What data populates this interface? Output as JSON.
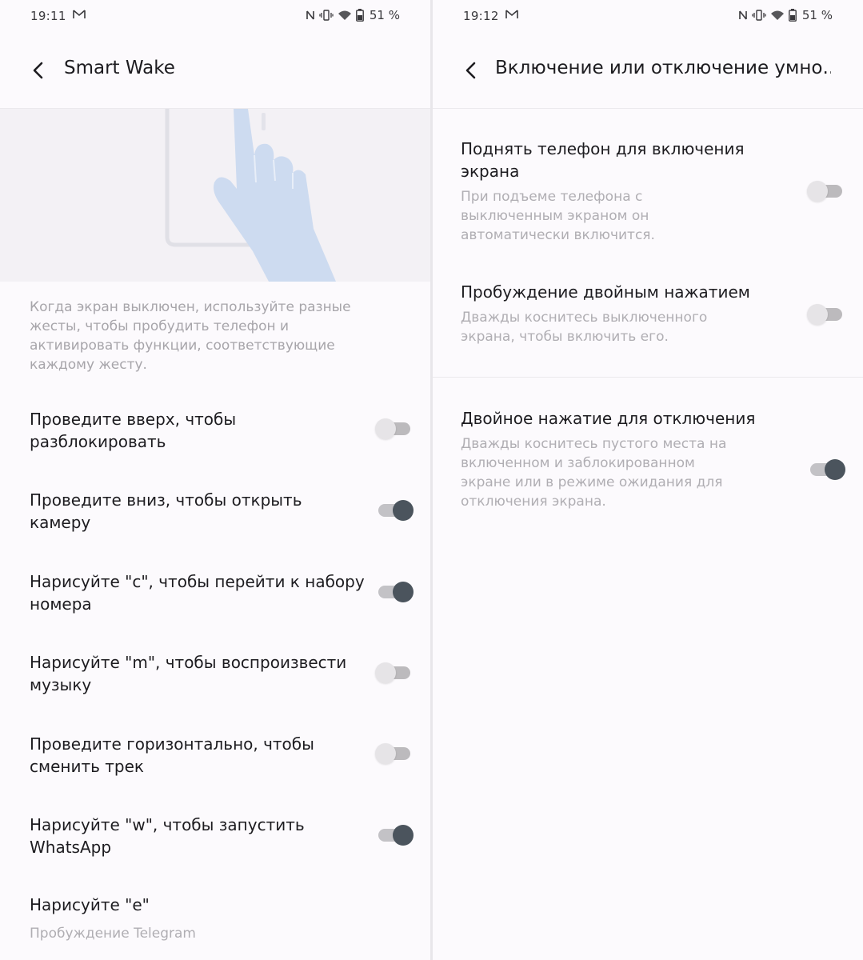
{
  "left": {
    "status": {
      "time": "19:11",
      "battery": "51 %"
    },
    "header": {
      "title": "Smart Wake"
    },
    "description": "Когда экран выключен, используйте разные жесты, чтобы пробудить телефон и активировать функции, соответствующие каждому жесту.",
    "settings": [
      {
        "title": "Проведите вверх, чтобы разблокировать",
        "enabled": false
      },
      {
        "title": "Проведите вниз, чтобы открыть камеру",
        "enabled": true
      },
      {
        "title": "Нарисуйте \"c\", чтобы перейти к набору номера",
        "enabled": true
      },
      {
        "title": "Нарисуйте \"m\", чтобы воспроизвести музыку",
        "enabled": false
      },
      {
        "title": "Проведите горизонтально, чтобы сменить трек",
        "enabled": false
      },
      {
        "title": "Нарисуйте \"w\", чтобы запустить WhatsApp",
        "enabled": true
      },
      {
        "title": "Нарисуйте \"e\"",
        "summary": "Пробуждение Telegram"
      }
    ]
  },
  "right": {
    "status": {
      "time": "19:12",
      "battery": "51 %"
    },
    "header": {
      "title": "Включение или отключение умно..."
    },
    "settings": [
      {
        "title": "Поднять телефон для включения экрана",
        "summary": "При подъеме телефона с выключенным экраном он автоматически включится.",
        "enabled": false
      },
      {
        "title": "Пробуждение двойным нажатием",
        "summary": "Дважды коснитесь выключенного экрана, чтобы включить его.",
        "enabled": false
      },
      {
        "title": "Двойное нажатие для отключения",
        "summary": "Дважды коснитесь пустого места на включенном и заблокированном экране или в режиме ожидания для отключения экрана.",
        "enabled": true
      }
    ]
  },
  "colors": {
    "toggle_on": "#4b545d",
    "toggle_off": "#e6e4e7",
    "background": "#fcfafd",
    "secondary_text": "#a7a5aa"
  }
}
